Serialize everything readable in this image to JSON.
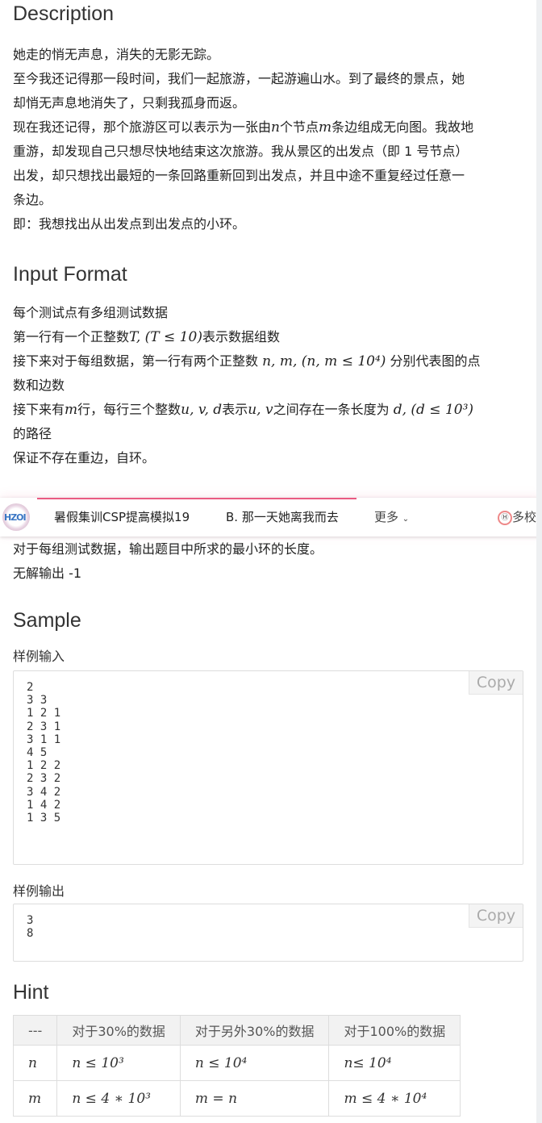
{
  "description": {
    "heading": "Description",
    "lines": [
      [
        {
          "t": "她走的悄无声息，消失的无影无踪。"
        }
      ],
      [
        {
          "t": "至今我还记得那一段时间，我们一起旅游，一起游遍山水。到了最终的景点，她"
        }
      ],
      [
        {
          "t": "却悄无声息地消失了，只剩我孤身而返。"
        }
      ],
      [
        {
          "t": "现在我还记得，那个旅游区可以表示为一张由"
        },
        {
          "t": "n",
          "m": true
        },
        {
          "t": "个节点"
        },
        {
          "t": "m",
          "m": true
        },
        {
          "t": "条边组成无向图。我故地"
        }
      ],
      [
        {
          "t": "重游，却发现自己只想尽快地结束这次旅游。我从景区的出发点（即 1 号节点）"
        }
      ],
      [
        {
          "t": "出发，却只想找出最短的一条回路重新回到出发点，并且中途不重复经过任意一"
        }
      ],
      [
        {
          "t": "条边。"
        }
      ],
      [
        {
          "t": "即：我想找出从出发点到出发点的小环。"
        }
      ]
    ]
  },
  "input_format": {
    "heading": "Input Format",
    "lines": [
      [
        {
          "t": "每个测试点有多组测试数据"
        }
      ],
      [
        {
          "t": "第一行有一个正整数"
        },
        {
          "t": "T, (T ≤ 10)",
          "m": true
        },
        {
          "t": "表示数据组数"
        }
      ],
      [
        {
          "t": "接下来对于每组数据，第一行有两个正整数 "
        },
        {
          "t": "n, m, (n, m ≤ 10⁴)",
          "m": true
        },
        {
          "t": " 分别代表图的点"
        }
      ],
      [
        {
          "t": "数和边数"
        }
      ],
      [
        {
          "t": "接下来有"
        },
        {
          "t": "m",
          "m": true
        },
        {
          "t": "行，每行三个整数"
        },
        {
          "t": "u, v, d",
          "m": true
        },
        {
          "t": "表示"
        },
        {
          "t": "u, v",
          "m": true
        },
        {
          "t": "之间存在一条长度为 "
        },
        {
          "t": "d, (d ≤ 10³)",
          "m": true
        }
      ],
      [
        {
          "t": "的路径"
        }
      ],
      [
        {
          "t": "保证不存在重边，自环。"
        }
      ]
    ]
  },
  "output_format": {
    "lines": [
      [
        {
          "t": "对于每组测试数据，输出题目中所求的最小环的长度。"
        }
      ],
      [
        {
          "t": "无解输出 -1"
        }
      ]
    ]
  },
  "navbar": {
    "logo_text": "HZOI",
    "contest": "暑假集训CSP提高模拟19",
    "problem": "B. 那一天她离我而去",
    "more": "更多",
    "more_icon": "chevron-down-icon",
    "school": "多校",
    "accent_color": "#ea5a82"
  },
  "sample": {
    "heading": "Sample",
    "input_label": "样例输入",
    "input": "2\n3 3\n1 2 1\n2 3 1\n3 1 1\n4 5\n1 2 2\n2 3 2\n3 4 2\n1 4 2\n1 3 5",
    "output_label": "样例输出",
    "output": "3\n8",
    "copy_label": "Copy"
  },
  "hint": {
    "heading": "Hint",
    "headers": [
      "---",
      "对于30%的数据",
      "对于另外30%的数据",
      "对于100%的数据"
    ],
    "rows": [
      [
        "n",
        "n ≤ 10³",
        "n ≤ 10⁴",
        "n≤ 10⁴"
      ],
      [
        "m",
        "n ≤ 4 ∗ 10³",
        "m = n",
        "m ≤ 4 ∗ 10⁴"
      ]
    ]
  }
}
